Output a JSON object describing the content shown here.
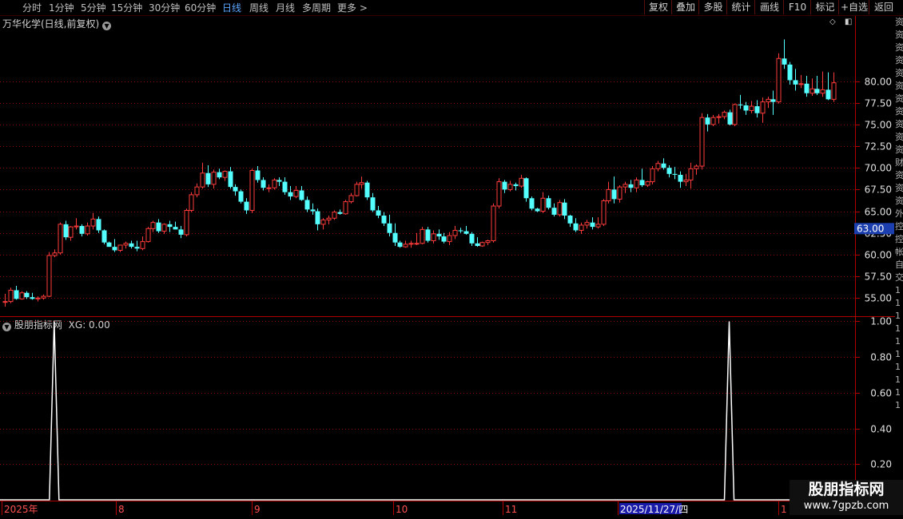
{
  "toolbar": {
    "periods": [
      "分时",
      "1分钟",
      "5分钟",
      "15分钟",
      "30分钟",
      "60分钟",
      "日线",
      "周线",
      "月线",
      "多周期",
      "更多 >"
    ],
    "active_period": "日线",
    "right_buttons": [
      "复权",
      "叠加",
      "多股",
      "统计",
      "画线",
      "F10",
      "标记",
      "+自选",
      "返回"
    ]
  },
  "main_panel": {
    "title": "万华化学(日线,前复权)"
  },
  "indicator_panel": {
    "title": "股朋指标网",
    "value_label": "XG: 0.00"
  },
  "price_tag": "63.00",
  "right_side_glyphs": [
    "资",
    "资",
    "资",
    "资",
    "资",
    "资",
    "资",
    "资",
    "资",
    "资",
    "资",
    "财",
    "资",
    "资",
    "资",
    "外",
    "控",
    "控",
    "帐",
    "自",
    "交",
    "1",
    "1",
    "1",
    "1",
    "1",
    "1",
    "1",
    "1",
    "1",
    "1"
  ],
  "date_axis": [
    "2025年",
    "8",
    "9",
    "10",
    "11",
    "2025/11/27/四",
    "1"
  ],
  "watermark": {
    "name": "股朋指标网",
    "url": "www.7gpzb.com"
  },
  "colors": {
    "up": "#ff3b3b",
    "down": "#54ffff",
    "grid": "#8b0000",
    "axis_text": "#e0e0e0",
    "signal": "#ffffff",
    "active_tab": "#5ba6ff"
  },
  "chart_data": [
    {
      "type": "candlestick",
      "title": "万华化学(日线,前复权)",
      "ylim": [
        53.0,
        87.5
      ],
      "yticks": [
        55.0,
        57.5,
        60.0,
        62.5,
        65.0,
        67.5,
        70.0,
        72.5,
        75.0,
        77.5,
        80.0
      ],
      "grid": true,
      "ohlc": [
        [
          54.5,
          55.5,
          54.0,
          54.6
        ],
        [
          54.6,
          56.2,
          54.4,
          55.9
        ],
        [
          55.9,
          56.4,
          54.8,
          54.9
        ],
        [
          54.9,
          55.8,
          54.8,
          55.6
        ],
        [
          55.6,
          55.8,
          54.9,
          55.1
        ],
        [
          55.1,
          55.6,
          54.8,
          54.9
        ],
        [
          54.9,
          55.2,
          54.6,
          55.0
        ],
        [
          55.0,
          55.4,
          54.8,
          55.2
        ],
        [
          55.2,
          60.3,
          55.1,
          59.9
        ],
        [
          59.9,
          60.6,
          59.7,
          60.2
        ],
        [
          60.2,
          63.7,
          60.0,
          63.5
        ],
        [
          63.5,
          63.9,
          61.7,
          62.0
        ],
        [
          62.0,
          63.3,
          61.6,
          63.2
        ],
        [
          63.2,
          64.2,
          62.9,
          63.3
        ],
        [
          63.3,
          63.5,
          62.1,
          62.4
        ],
        [
          62.4,
          63.7,
          62.2,
          63.3
        ],
        [
          63.3,
          64.8,
          62.9,
          64.1
        ],
        [
          64.1,
          64.4,
          62.5,
          62.8
        ],
        [
          62.8,
          62.9,
          61.2,
          61.4
        ],
        [
          61.4,
          61.5,
          60.9,
          60.9
        ],
        [
          60.9,
          61.8,
          60.3,
          60.5
        ],
        [
          60.5,
          61.1,
          60.3,
          61.1
        ],
        [
          61.1,
          61.5,
          60.7,
          61.3
        ],
        [
          61.3,
          61.6,
          60.7,
          60.9
        ],
        [
          60.9,
          61.6,
          60.4,
          60.7
        ],
        [
          60.7,
          62.1,
          60.5,
          61.5
        ],
        [
          61.5,
          63.2,
          61.4,
          63.0
        ],
        [
          63.0,
          63.9,
          62.6,
          63.7
        ],
        [
          63.7,
          64.1,
          62.5,
          62.7
        ],
        [
          62.7,
          63.6,
          62.4,
          63.5
        ],
        [
          63.5,
          63.9,
          62.6,
          63.2
        ],
        [
          63.2,
          63.8,
          62.9,
          62.9
        ],
        [
          62.9,
          63.3,
          61.9,
          62.3
        ],
        [
          62.3,
          65.3,
          62.1,
          65.1
        ],
        [
          65.1,
          67.2,
          64.9,
          66.9
        ],
        [
          66.9,
          68.2,
          66.6,
          67.8
        ],
        [
          67.8,
          70.6,
          67.6,
          69.4
        ],
        [
          69.4,
          70.3,
          67.8,
          68.1
        ],
        [
          68.1,
          69.8,
          67.6,
          69.5
        ],
        [
          69.5,
          69.9,
          68.7,
          68.9
        ],
        [
          68.9,
          69.7,
          68.5,
          69.6
        ],
        [
          69.6,
          70.1,
          67.6,
          67.8
        ],
        [
          67.8,
          68.1,
          66.8,
          67.3
        ],
        [
          67.3,
          67.5,
          65.9,
          66.1
        ],
        [
          66.1,
          66.5,
          64.7,
          65.1
        ],
        [
          65.1,
          69.9,
          64.8,
          69.7
        ],
        [
          69.7,
          70.2,
          68.3,
          68.6
        ],
        [
          68.6,
          68.9,
          67.4,
          67.7
        ],
        [
          67.7,
          68.1,
          67.2,
          67.7
        ],
        [
          67.7,
          68.8,
          67.5,
          68.6
        ],
        [
          68.6,
          68.9,
          67.9,
          68.4
        ],
        [
          68.4,
          68.9,
          66.9,
          67.2
        ],
        [
          67.2,
          67.9,
          66.3,
          66.7
        ],
        [
          66.7,
          67.9,
          66.5,
          67.4
        ],
        [
          67.4,
          67.9,
          66.2,
          66.3
        ],
        [
          66.3,
          66.7,
          64.9,
          65.2
        ],
        [
          65.2,
          65.9,
          64.6,
          65.0
        ],
        [
          65.0,
          65.3,
          62.8,
          63.5
        ],
        [
          63.5,
          64.2,
          62.9,
          64.0
        ],
        [
          64.0,
          64.5,
          63.5,
          64.2
        ],
        [
          64.2,
          65.1,
          64.0,
          64.9
        ],
        [
          64.9,
          65.2,
          64.6,
          64.7
        ],
        [
          64.7,
          66.3,
          64.6,
          66.1
        ],
        [
          66.1,
          67.1,
          65.9,
          66.8
        ],
        [
          66.8,
          68.4,
          66.7,
          68.1
        ],
        [
          68.1,
          69.0,
          67.6,
          68.3
        ],
        [
          68.3,
          68.5,
          66.3,
          66.6
        ],
        [
          66.6,
          67.1,
          64.9,
          65.1
        ],
        [
          65.1,
          65.6,
          64.2,
          64.5
        ],
        [
          64.5,
          64.9,
          63.3,
          63.6
        ],
        [
          63.6,
          64.6,
          62.1,
          62.5
        ],
        [
          62.5,
          63.6,
          61.0,
          61.4
        ],
        [
          61.4,
          61.6,
          60.8,
          60.9
        ],
        [
          60.9,
          61.6,
          60.8,
          61.2
        ],
        [
          61.2,
          61.6,
          60.8,
          61.3
        ],
        [
          61.3,
          62.5,
          61.1,
          61.3
        ],
        [
          61.3,
          63.2,
          61.2,
          62.9
        ],
        [
          62.9,
          63.2,
          61.4,
          61.6
        ],
        [
          61.6,
          62.8,
          61.3,
          62.4
        ],
        [
          62.4,
          62.9,
          61.7,
          62.1
        ],
        [
          62.1,
          62.5,
          61.3,
          61.5
        ],
        [
          61.5,
          62.6,
          61.1,
          62.2
        ],
        [
          62.2,
          63.3,
          61.8,
          62.8
        ],
        [
          62.8,
          63.1,
          62.5,
          62.7
        ],
        [
          62.7,
          63.3,
          62.3,
          62.4
        ],
        [
          62.4,
          62.6,
          61.0,
          61.3
        ],
        [
          61.3,
          62.0,
          60.9,
          61.0
        ],
        [
          61.0,
          61.5,
          60.9,
          61.4
        ],
        [
          61.4,
          61.7,
          61.1,
          61.6
        ],
        [
          61.6,
          65.9,
          61.4,
          65.6
        ],
        [
          65.6,
          68.8,
          65.3,
          68.4
        ],
        [
          68.4,
          68.6,
          67.1,
          67.5
        ],
        [
          67.5,
          68.5,
          67.3,
          68.1
        ],
        [
          68.1,
          68.3,
          67.4,
          67.9
        ],
        [
          67.9,
          69.2,
          67.7,
          68.8
        ],
        [
          68.8,
          68.9,
          66.1,
          66.5
        ],
        [
          66.5,
          66.7,
          65.1,
          65.3
        ],
        [
          65.3,
          65.4,
          64.9,
          65.0
        ],
        [
          65.0,
          67.2,
          64.8,
          66.5
        ],
        [
          66.5,
          66.8,
          65.2,
          65.4
        ],
        [
          65.4,
          65.9,
          64.4,
          64.6
        ],
        [
          64.6,
          66.3,
          64.4,
          66.0
        ],
        [
          66.0,
          66.4,
          64.1,
          64.5
        ],
        [
          64.5,
          64.6,
          63.2,
          63.6
        ],
        [
          63.6,
          64.2,
          62.6,
          62.8
        ],
        [
          62.8,
          63.7,
          62.4,
          63.4
        ],
        [
          63.4,
          64.0,
          63.0,
          63.7
        ],
        [
          63.7,
          64.3,
          62.9,
          63.2
        ],
        [
          63.2,
          64.3,
          63.0,
          63.5
        ],
        [
          63.5,
          66.4,
          63.3,
          66.2
        ],
        [
          66.2,
          68.4,
          65.9,
          67.5
        ],
        [
          67.5,
          69.0,
          65.9,
          66.4
        ],
        [
          66.4,
          68.0,
          66.0,
          67.8
        ],
        [
          67.8,
          68.4,
          67.1,
          68.1
        ],
        [
          68.1,
          68.6,
          67.2,
          67.7
        ],
        [
          67.7,
          68.9,
          67.2,
          68.6
        ],
        [
          68.6,
          69.9,
          67.8,
          68.0
        ],
        [
          68.0,
          68.5,
          67.8,
          68.4
        ],
        [
          68.4,
          70.2,
          68.1,
          69.9
        ],
        [
          69.9,
          70.8,
          69.6,
          70.5
        ],
        [
          70.5,
          71.1,
          69.8,
          70.0
        ],
        [
          70.0,
          70.3,
          68.9,
          69.3
        ],
        [
          69.3,
          70.1,
          68.7,
          69.2
        ],
        [
          69.2,
          69.6,
          67.7,
          68.4
        ],
        [
          68.4,
          69.3,
          67.9,
          68.6
        ],
        [
          68.6,
          70.6,
          67.6,
          69.9
        ],
        [
          69.9,
          70.4,
          69.2,
          70.2
        ],
        [
          70.2,
          76.3,
          69.8,
          75.8
        ],
        [
          75.8,
          76.2,
          74.2,
          75.0
        ],
        [
          75.0,
          76.1,
          74.8,
          75.8
        ],
        [
          75.8,
          76.2,
          75.1,
          75.9
        ],
        [
          75.9,
          76.6,
          75.6,
          76.4
        ],
        [
          76.4,
          76.7,
          74.9,
          75.0
        ],
        [
          75.0,
          77.4,
          74.8,
          77.3
        ],
        [
          77.3,
          78.4,
          76.8,
          77.2
        ],
        [
          77.2,
          77.6,
          76.1,
          76.6
        ],
        [
          76.6,
          77.7,
          76.3,
          77.1
        ],
        [
          77.1,
          77.8,
          75.8,
          76.3
        ],
        [
          76.3,
          78.1,
          75.2,
          77.6
        ],
        [
          77.6,
          78.2,
          76.9,
          77.9
        ],
        [
          77.9,
          78.9,
          76.1,
          77.6
        ],
        [
          77.6,
          83.2,
          77.4,
          82.6
        ],
        [
          82.6,
          84.8,
          81.4,
          81.9
        ],
        [
          81.9,
          82.2,
          79.6,
          80.1
        ],
        [
          80.1,
          81.4,
          78.9,
          79.6
        ],
        [
          79.6,
          80.7,
          79.2,
          79.7
        ],
        [
          79.7,
          80.6,
          78.2,
          78.6
        ],
        [
          78.6,
          80.3,
          78.3,
          79.1
        ],
        [
          79.1,
          80.6,
          78.4,
          78.6
        ],
        [
          78.6,
          81.1,
          78.2,
          79.0
        ],
        [
          79.0,
          81.0,
          77.8,
          77.9
        ],
        [
          77.9,
          81.0,
          77.6,
          79.8
        ]
      ]
    },
    {
      "type": "line",
      "series": [
        {
          "name": "XG",
          "description": "signal spikes to 1.00 at two dates"
        }
      ],
      "ylim": [
        0,
        1.02
      ],
      "yticks": [
        0.2,
        0.4,
        0.6,
        0.8,
        1.0
      ],
      "spikes_at_index": [
        9,
        132
      ],
      "values_note": "0 everywhere except 1.00 at spike indices"
    }
  ]
}
